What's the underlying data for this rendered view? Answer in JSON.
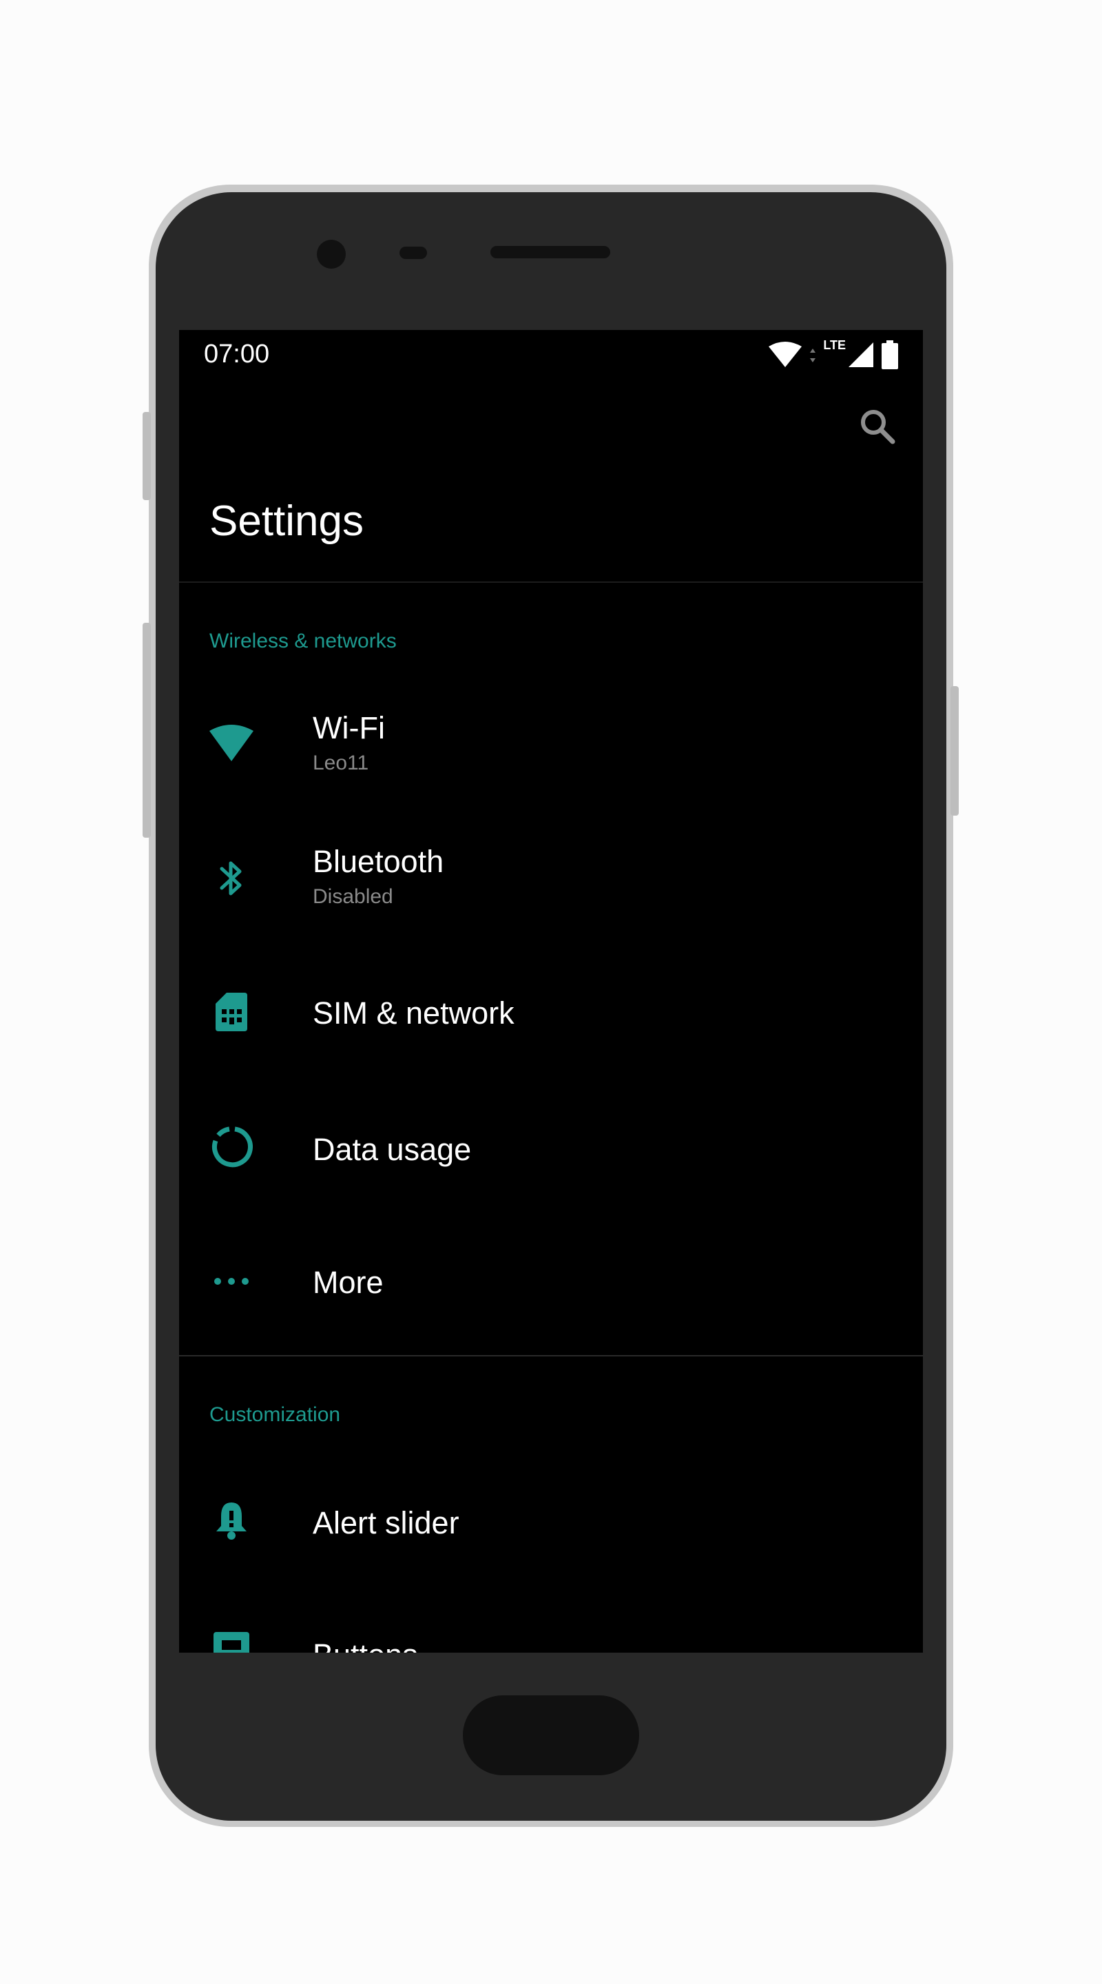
{
  "status_bar": {
    "time": "07:00",
    "network_label": "LTE",
    "icons": [
      "wifi-icon",
      "data-arrows-icon",
      "cell-signal-icon",
      "battery-icon"
    ]
  },
  "toolbar": {
    "search_icon": "search-icon"
  },
  "title": "Settings",
  "sections": [
    {
      "header": "Wireless & networks",
      "items": [
        {
          "label": "Wi-Fi",
          "summary": "Leo11",
          "icon": "wifi-icon"
        },
        {
          "label": "Bluetooth",
          "summary": "Disabled",
          "icon": "bluetooth-icon"
        },
        {
          "label": "SIM & network",
          "icon": "sim-card-icon"
        },
        {
          "label": "Data usage",
          "icon": "data-usage-icon"
        },
        {
          "label": "More",
          "icon": "more-dots-icon"
        }
      ]
    },
    {
      "header": "Customization",
      "items": [
        {
          "label": "Alert slider",
          "icon": "bell-icon"
        },
        {
          "label": "Buttons",
          "icon": "buttons-icon"
        }
      ]
    }
  ],
  "colors": {
    "accent": "#1e9a8f",
    "background": "#000000",
    "primary_text": "#ffffff",
    "secondary_text": "#8a8a8a",
    "phone_body": "#282828"
  }
}
